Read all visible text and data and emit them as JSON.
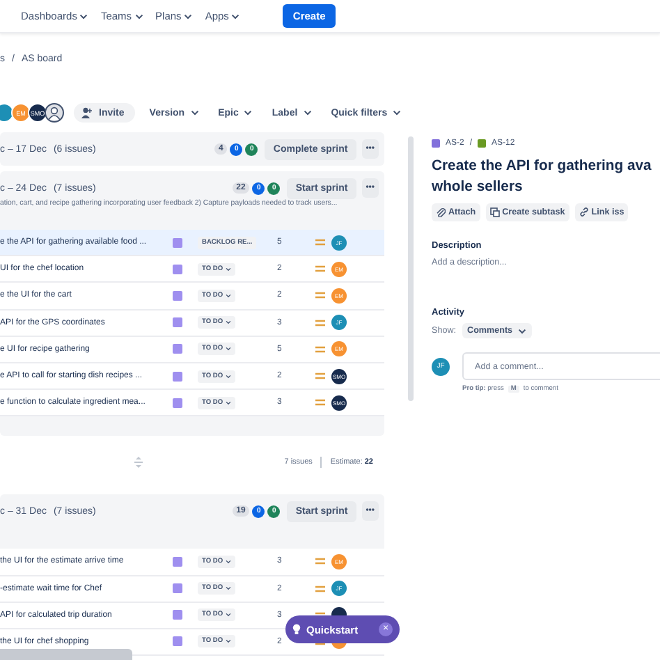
{
  "nav": {
    "items": [
      {
        "label": "Dashboards"
      },
      {
        "label": "Teams"
      },
      {
        "label": "Plans"
      },
      {
        "label": "Apps"
      }
    ],
    "create": "Create"
  },
  "breadcrumb": {
    "items": [
      "s",
      "AS board"
    ],
    "separator": "/"
  },
  "filters": {
    "avatars": [
      {
        "kind": "blank",
        "color": "#1d8fb5"
      },
      {
        "kind": "initials",
        "text": "EM",
        "color": "#f79232"
      },
      {
        "kind": "initials",
        "text": "SMO",
        "color": "#172b4d"
      },
      {
        "kind": "person",
        "color": "#dfe1e6"
      }
    ],
    "invite": "Invite",
    "dropdowns": [
      "Version",
      "Epic",
      "Label",
      "Quick filters"
    ]
  },
  "sprints": [
    {
      "dates": "c – 17 Dec",
      "count": "(6 issues)",
      "points": "4",
      "in_progress": "0",
      "done": "0",
      "action": "Complete sprint",
      "more": "•••"
    },
    {
      "dates": "c – 24 Dec",
      "count": "(7 issues)",
      "points": "22",
      "in_progress": "0",
      "done": "0",
      "action": "Start sprint",
      "more": "•••",
      "goal": "ation, cart, and recipe gathering incorporating user feedback 2) Capture payloads needed to track users...",
      "footer": {
        "issues": "7 issues",
        "estimate_label": "Estimate:",
        "estimate": "22"
      },
      "rows": [
        {
          "title": "e the API for gathering available food ...",
          "status": "BACKLOG RE...",
          "points": "5",
          "assignee": {
            "initials": "JF",
            "color": "#1d8fb5"
          },
          "selected": true
        },
        {
          "title": "UI for the chef location",
          "status": "TO DO",
          "points": "2",
          "assignee": {
            "initials": "EM",
            "color": "#f79232"
          },
          "selected": false
        },
        {
          "title": "e the UI for the cart",
          "status": "TO DO",
          "points": "2",
          "assignee": {
            "initials": "EM",
            "color": "#f79232"
          },
          "selected": false
        },
        {
          "title": "API for the GPS coordinates",
          "status": "TO DO",
          "points": "3",
          "assignee": {
            "initials": "JF",
            "color": "#1d8fb5"
          },
          "selected": false
        },
        {
          "title": "e UI for recipe gathering",
          "status": "TO DO",
          "points": "5",
          "assignee": {
            "initials": "EM",
            "color": "#f79232"
          },
          "selected": false
        },
        {
          "title": "e API to call for starting dish recipes ...",
          "status": "TO DO",
          "points": "2",
          "assignee": {
            "initials": "SMO",
            "color": "#172b4d"
          },
          "selected": false
        },
        {
          "title": "e function to calculate ingredient mea...",
          "status": "TO DO",
          "points": "3",
          "assignee": {
            "initials": "SMO",
            "color": "#172b4d"
          },
          "selected": false
        }
      ]
    },
    {
      "dates": "c – 31 Dec",
      "count": "(7 issues)",
      "points": "19",
      "in_progress": "0",
      "done": "0",
      "action": "Start sprint",
      "more": "•••",
      "rows": [
        {
          "title": "the UI for the estimate arrive time",
          "status": "TO DO",
          "points": "3",
          "assignee": {
            "initials": "EM",
            "color": "#f79232"
          },
          "selected": false
        },
        {
          "title": "-estimate wait time for Chef",
          "status": "TO DO",
          "points": "2",
          "assignee": {
            "initials": "JF",
            "color": "#1d8fb5"
          },
          "selected": false
        },
        {
          "title": "API for calculated trip duration",
          "status": "TO DO",
          "points": "3",
          "assignee": {
            "color": "#172b4d"
          },
          "selected": false
        },
        {
          "title": "the UI for chef shopping",
          "status": "TO DO",
          "points": "2",
          "assignee": {
            "color": "#f79232"
          },
          "selected": false
        }
      ]
    }
  ],
  "detail": {
    "parent": "AS-2",
    "separator": "/",
    "key": "AS-12",
    "title": "Create the API for gathering ava\nwhole sellers",
    "actions": [
      {
        "kind": "attach",
        "label": "Attach"
      },
      {
        "kind": "subtask",
        "label": "Create subtask"
      },
      {
        "kind": "link",
        "label": "Link iss"
      }
    ],
    "description_label": "Description",
    "description_placeholder": "Add a description...",
    "activity_label": "Activity",
    "show_label": "Show:",
    "show_value": "Comments",
    "comment_avatar": {
      "initials": "JF",
      "color": "#1d8fb5"
    },
    "comment_placeholder": "Add a comment...",
    "tip": "**Pro tip:** press",
    "tip_key": "M",
    "tip_end": "to comment"
  },
  "quickstart": {
    "label": "Quickstart",
    "close": "×"
  }
}
